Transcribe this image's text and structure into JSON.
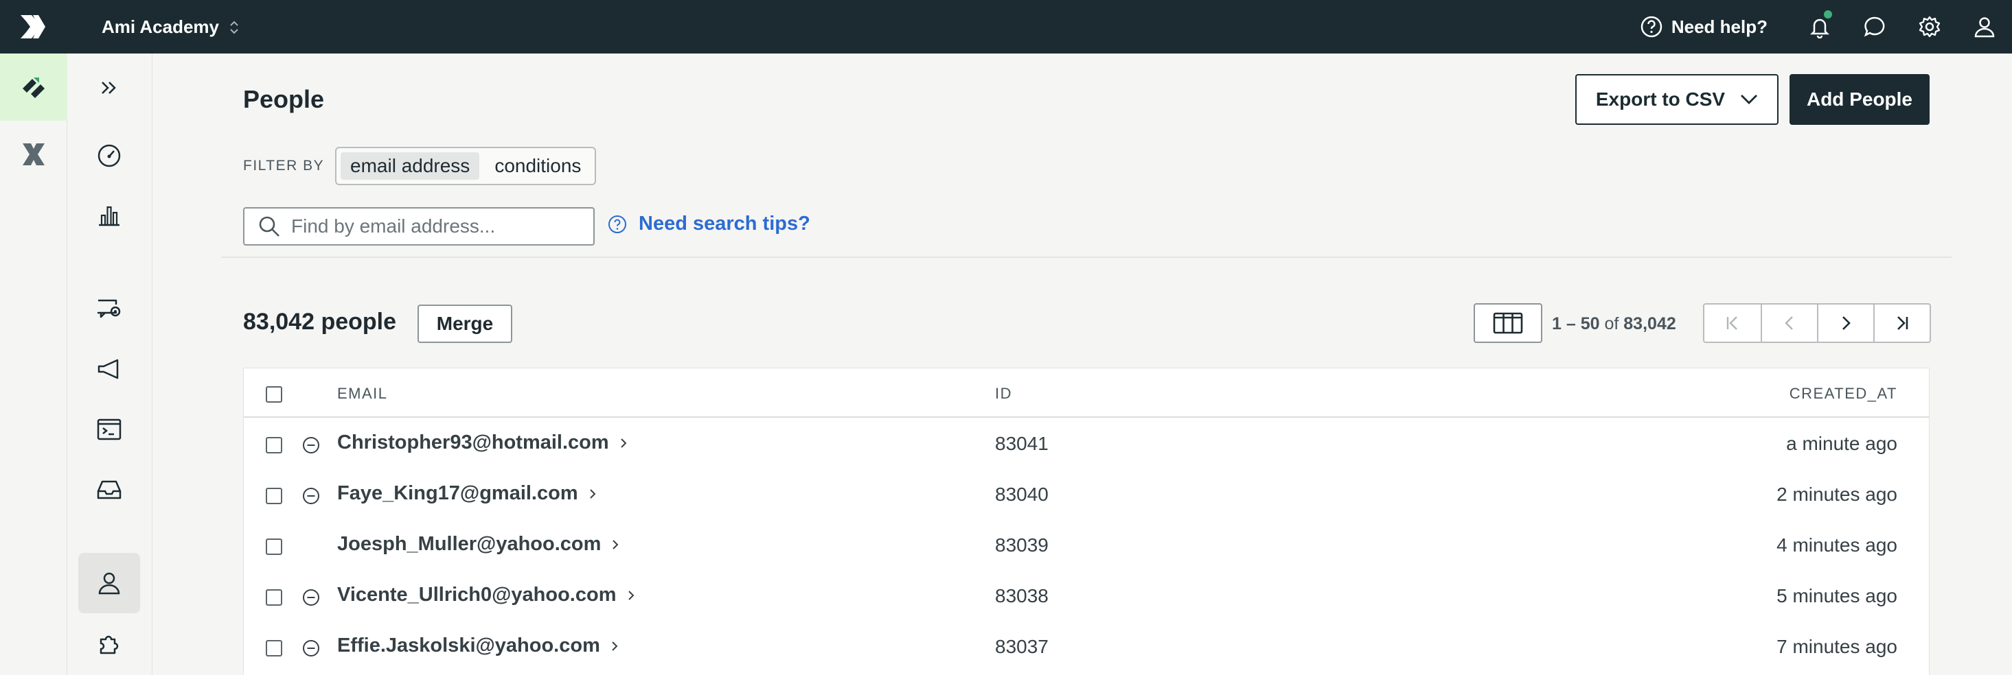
{
  "topbar": {
    "workspace": "Ami Academy",
    "help_label": "Need help?",
    "icons": [
      "help-circle-icon",
      "bell-icon",
      "chat-icon",
      "gear-icon",
      "user-icon"
    ]
  },
  "page": {
    "title": "People",
    "export_label": "Export to CSV",
    "add_label": "Add People"
  },
  "filter": {
    "label": "FILTER BY",
    "options": [
      "email address",
      "conditions"
    ],
    "selected": "email address"
  },
  "search": {
    "placeholder": "Find by email address...",
    "tips_label": "Need search tips?"
  },
  "summary": {
    "count": "83,042 people",
    "merge_label": "Merge",
    "range": "1 – 50",
    "of": "of",
    "total": "83,042"
  },
  "table": {
    "columns": [
      "EMAIL",
      "ID",
      "CREATED_AT"
    ],
    "rows": [
      {
        "email": "Christopher93@hotmail.com",
        "id": "83041",
        "created": "a minute ago",
        "status": true
      },
      {
        "email": "Faye_King17@gmail.com",
        "id": "83040",
        "created": "2 minutes ago",
        "status": true
      },
      {
        "email": "Joesph_Muller@yahoo.com",
        "id": "83039",
        "created": "4 minutes ago",
        "status": false
      },
      {
        "email": "Vicente_Ullrich0@yahoo.com",
        "id": "83038",
        "created": "5 minutes ago",
        "status": true
      },
      {
        "email": "Effie.Jaskolski@yahoo.com",
        "id": "83037",
        "created": "7 minutes ago",
        "status": true
      }
    ]
  },
  "colors": {
    "topbar_bg": "#1b2b31",
    "accent_link": "#2c6bd1",
    "rail_active": "#dff5d8",
    "notification_dot": "#3fb07a"
  }
}
